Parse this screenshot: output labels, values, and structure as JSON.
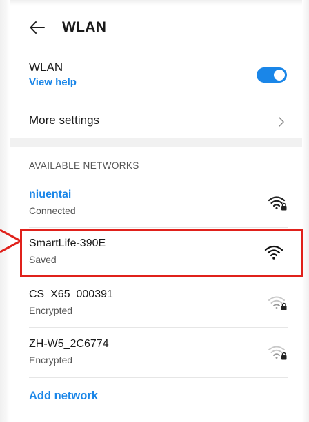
{
  "header": {
    "title": "WLAN",
    "back_icon": "arrow-left-icon"
  },
  "wlan_toggle": {
    "label": "WLAN",
    "help_link": "View help",
    "state": "on",
    "accent_color": "#1a86e8"
  },
  "more_settings": {
    "label": "More settings",
    "icon": "chevron-right-icon"
  },
  "networks_section": {
    "label": "AVAILABLE NETWORKS",
    "items": [
      {
        "name": "niuentai",
        "status": "Connected",
        "secured": true,
        "signal": "full",
        "connected": true
      },
      {
        "name": "SmartLife-390E",
        "status": "Saved",
        "secured": false,
        "signal": "full",
        "connected": false,
        "highlighted": true
      },
      {
        "name": "CS_X65_000391",
        "status": "Encrypted",
        "secured": true,
        "signal": "weak",
        "connected": false
      },
      {
        "name": "ZH-W5_2C6774",
        "status": "Encrypted",
        "secured": true,
        "signal": "weak",
        "connected": false
      }
    ]
  },
  "add_network": {
    "label": "Add network"
  },
  "annotation": {
    "highlight_color": "#e0211b"
  }
}
